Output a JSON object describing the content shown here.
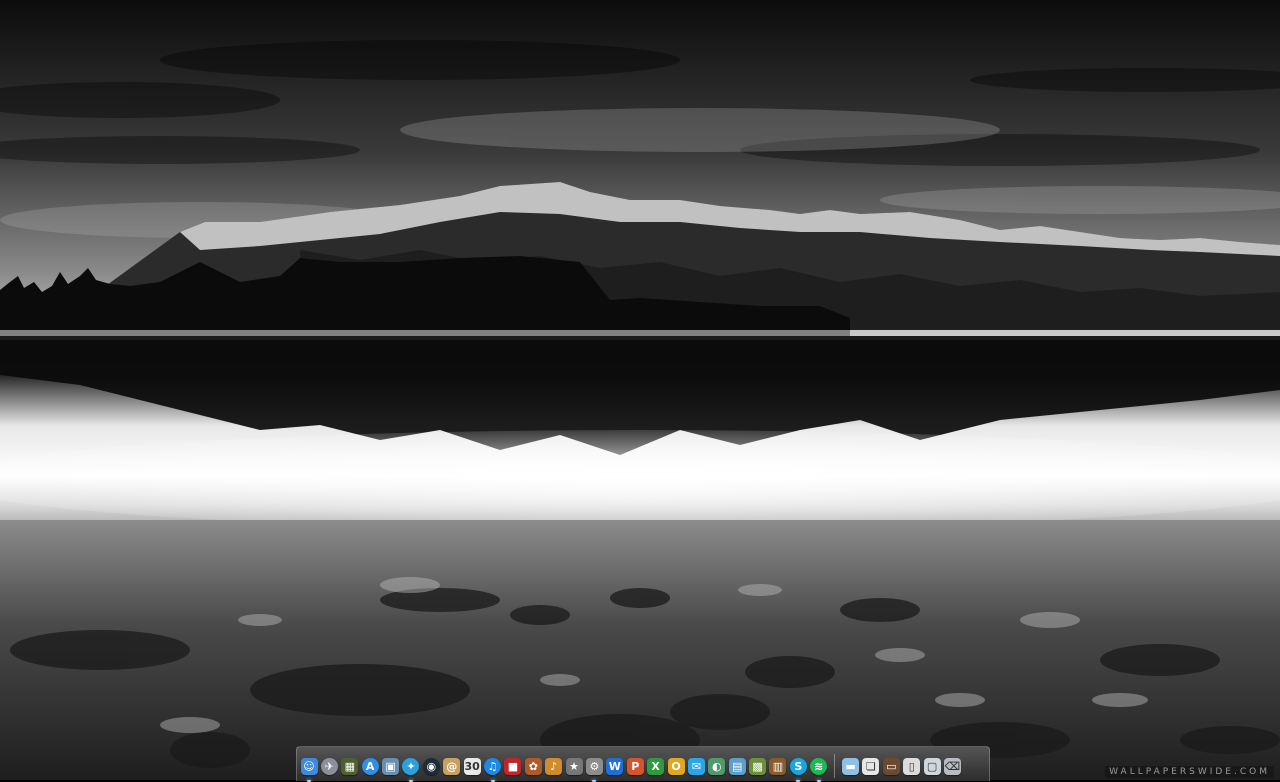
{
  "desktop": {
    "wallpaper": "Black and white mountain range reflected in a calm lake with pebbles",
    "watermark": "WALLPAPERSWIDE.COM"
  },
  "dock": {
    "apps": [
      {
        "name": "finder",
        "icon": "finder-icon",
        "glyph": "☺",
        "color": "#3b8be0",
        "round": false,
        "running": true
      },
      {
        "name": "launchpad",
        "icon": "rocket-icon",
        "glyph": "✈",
        "color": "#8a8f99",
        "round": true,
        "running": false
      },
      {
        "name": "mission-control",
        "icon": "mission-control-icon",
        "glyph": "▦",
        "color": "#4f5f2f",
        "round": false,
        "running": false
      },
      {
        "name": "app-store",
        "icon": "app-store-icon",
        "glyph": "A",
        "color": "#2f8ee8",
        "round": true,
        "running": false
      },
      {
        "name": "preview",
        "icon": "preview-icon",
        "glyph": "▣",
        "color": "#6a8fb0",
        "round": false,
        "running": false
      },
      {
        "name": "safari",
        "icon": "safari-icon",
        "glyph": "✦",
        "color": "#2aa0e0",
        "round": true,
        "running": true
      },
      {
        "name": "dashboard",
        "icon": "dashboard-icon",
        "glyph": "◉",
        "color": "#1d2b3a",
        "round": true,
        "running": false
      },
      {
        "name": "contacts",
        "icon": "contacts-icon",
        "glyph": "@",
        "color": "#c8a060",
        "round": false,
        "running": false
      },
      {
        "name": "calendar",
        "icon": "calendar-icon",
        "glyph": "30",
        "color": "#e8e8e8",
        "round": false,
        "running": false,
        "dark": true
      },
      {
        "name": "itunes",
        "icon": "itunes-icon",
        "glyph": "♫",
        "color": "#1b8ae6",
        "round": true,
        "running": true
      },
      {
        "name": "photo-booth",
        "icon": "photo-booth-icon",
        "glyph": "■",
        "color": "#c0252c",
        "round": false,
        "running": false
      },
      {
        "name": "photos",
        "icon": "photos-icon",
        "glyph": "✿",
        "color": "#b05a2a",
        "round": false,
        "running": false
      },
      {
        "name": "garageband",
        "icon": "guitar-icon",
        "glyph": "♪",
        "color": "#d08a30",
        "round": false,
        "running": false
      },
      {
        "name": "utility",
        "icon": "star-icon",
        "glyph": "★",
        "color": "#777777",
        "round": false,
        "running": false
      },
      {
        "name": "system-preferences",
        "icon": "gear-icon",
        "glyph": "⚙",
        "color": "#8c8c8c",
        "round": false,
        "running": true
      },
      {
        "name": "word",
        "icon": "word-icon",
        "glyph": "W",
        "color": "#1f6fd6",
        "round": false,
        "running": false
      },
      {
        "name": "powerpoint",
        "icon": "powerpoint-icon",
        "glyph": "P",
        "color": "#d9532a",
        "round": false,
        "running": false
      },
      {
        "name": "excel",
        "icon": "excel-icon",
        "glyph": "X",
        "color": "#2e9b3c",
        "round": false,
        "running": false
      },
      {
        "name": "outlook",
        "icon": "outlook-icon",
        "glyph": "O",
        "color": "#e0a822",
        "round": false,
        "running": false
      },
      {
        "name": "messages",
        "icon": "messages-icon",
        "glyph": "✉",
        "color": "#2aa6e8",
        "round": false,
        "running": false
      },
      {
        "name": "maps",
        "icon": "globe-icon",
        "glyph": "◐",
        "color": "#4f9a6a",
        "round": false,
        "running": false
      },
      {
        "name": "preview-2",
        "icon": "photo-icon",
        "glyph": "▤",
        "color": "#5aa0c8",
        "round": false,
        "running": false
      },
      {
        "name": "minecraft",
        "icon": "minecraft-icon",
        "glyph": "▩",
        "color": "#6b8f3a",
        "round": false,
        "running": false
      },
      {
        "name": "chest",
        "icon": "chest-icon",
        "glyph": "▥",
        "color": "#8a5a2a",
        "round": false,
        "running": false
      },
      {
        "name": "skype",
        "icon": "skype-icon",
        "glyph": "S",
        "color": "#16a6e5",
        "round": true,
        "running": true
      },
      {
        "name": "spotify",
        "icon": "spotify-icon",
        "glyph": "≋",
        "color": "#1db954",
        "round": true,
        "running": true
      }
    ],
    "stacks": [
      {
        "name": "applications-folder",
        "icon": "folder-icon",
        "glyph": "▬",
        "color": "#8fc0e6",
        "round": false
      },
      {
        "name": "documents",
        "icon": "document-icon",
        "glyph": "❏",
        "color": "#e6e6e6",
        "round": false,
        "dark": true
      },
      {
        "name": "downloads",
        "icon": "drawer-icon",
        "glyph": "▭",
        "color": "#6b4a30",
        "round": false
      },
      {
        "name": "files",
        "icon": "file-icon",
        "glyph": "▯",
        "color": "#dcdcdc",
        "round": false,
        "dark": true
      },
      {
        "name": "screenshots",
        "icon": "screenshot-icon",
        "glyph": "▢",
        "color": "#cfd6dc",
        "round": false,
        "dark": true
      },
      {
        "name": "trash",
        "icon": "trash-icon",
        "glyph": "⌫",
        "color": "#b8bcc2",
        "round": false,
        "dark": true
      }
    ]
  },
  "colors": {
    "sky_top": "#0e0e0e",
    "sky_mid": "#4a4a4a",
    "horizon": "#d9d9d9",
    "water_light": "#f4f4f4",
    "mountain_dark": "#222222",
    "snow": "#e8e8e8"
  }
}
